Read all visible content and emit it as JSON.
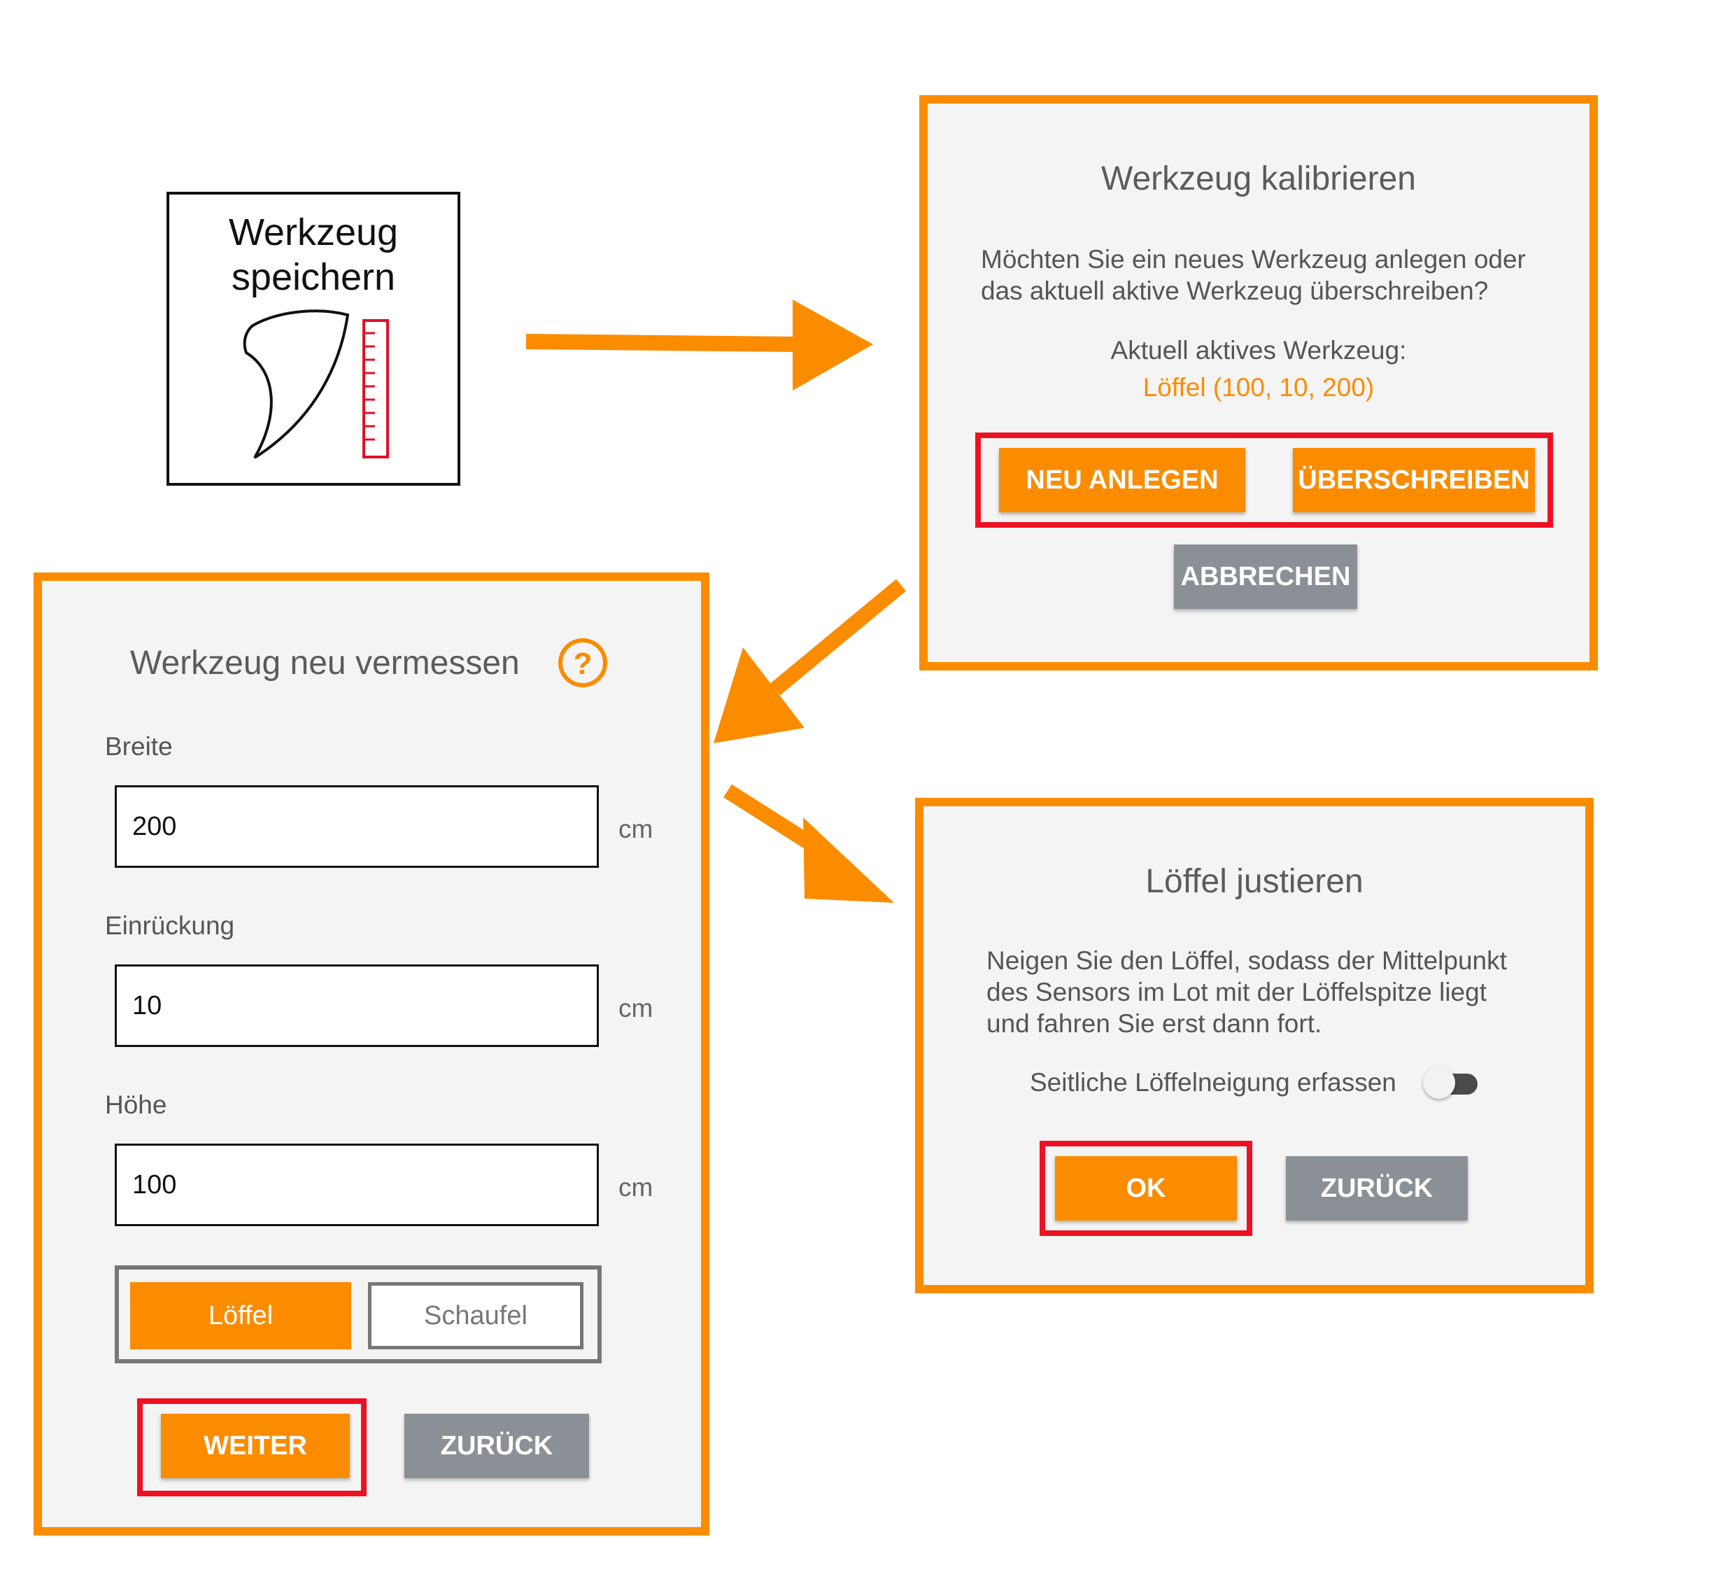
{
  "tool_tile": {
    "line1": "Werkzeug",
    "line2": "speichern",
    "icon": "bucket-measure-icon"
  },
  "calibrate_dialog": {
    "title": "Werkzeug kalibrieren",
    "question_line1": "Möchten Sie ein neues Werkzeug anlegen oder",
    "question_line2": "das aktuell aktive Werkzeug überschreiben?",
    "active_label": "Aktuell aktives Werkzeug:",
    "active_value": "Löffel (100, 10, 200)",
    "new_button": "NEU ANLEGEN",
    "overwrite_button": "ÜBERSCHREIBEN",
    "cancel_button": "ABBRECHEN"
  },
  "measure_dialog": {
    "title": "Werkzeug neu vermessen",
    "help_icon": "help-circle-icon",
    "fields": [
      {
        "label": "Breite",
        "value": "200",
        "unit": "cm"
      },
      {
        "label": "Einrückung",
        "value": "10",
        "unit": "cm"
      },
      {
        "label": "Höhe",
        "value": "100",
        "unit": "cm"
      }
    ],
    "toggle": {
      "option_a": "Löffel",
      "option_b": "Schaufel",
      "selected": "Löffel"
    },
    "next_button": "WEITER",
    "back_button": "ZURÜCK"
  },
  "adjust_dialog": {
    "title": "Löffel justieren",
    "text_line1": "Neigen Sie den Löffel, sodass der Mittelpunkt",
    "text_line2": "des Sensors im Lot mit der Löffelspitze liegt",
    "text_line3": "und fahren Sie erst dann fort.",
    "switch_label": "Seitliche Löffelneigung erfassen",
    "switch_on": false,
    "ok_button": "OK",
    "back_button": "ZURÜCK"
  },
  "colors": {
    "accent": "#fb8c00",
    "highlight": "#ee1122",
    "secondary_button": "#8a9096",
    "dialog_background": "#f4f4f4"
  }
}
